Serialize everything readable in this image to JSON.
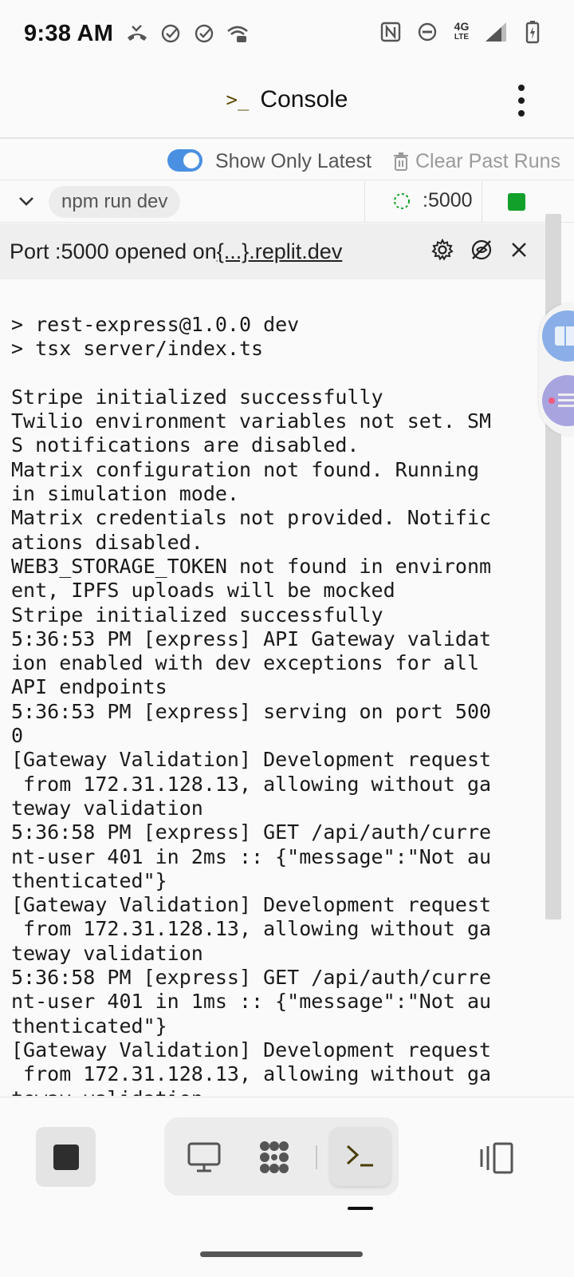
{
  "status_bar": {
    "time": "9:38 AM",
    "network_label": "4G",
    "network_sub": "LTE",
    "icons_left": [
      "missed-call-icon",
      "check-circle-icon",
      "check-circle-icon",
      "wifi-calling-icon"
    ],
    "icons_right": [
      "nfc-icon",
      "do-not-disturb-icon",
      "signal-icon",
      "battery-charging-icon"
    ]
  },
  "header": {
    "prompt_glyph": ">_",
    "title": "Console"
  },
  "toolbar": {
    "toggle_on": true,
    "toggle_label": "Show Only Latest",
    "clear_label": "Clear Past Runs"
  },
  "run": {
    "command": "npm run dev",
    "port_label": ":5000",
    "status_color": "#12a02a"
  },
  "port_banner": {
    "prefix": "Port :5000 opened on",
    "link": "{...}.replit.dev"
  },
  "console": {
    "output": "> rest-express@1.0.0 dev\n> tsx server/index.ts\n\nStripe initialized successfully\nTwilio environment variables not set. SM\nS notifications are disabled.\nMatrix configuration not found. Running\nin simulation mode.\nMatrix credentials not provided. Notific\nations disabled.\nWEB3_STORAGE_TOKEN not found in environm\nent, IPFS uploads will be mocked\nStripe initialized successfully\n5:36:53 PM [express] API Gateway validat\nion enabled with dev exceptions for all\nAPI endpoints\n5:36:53 PM [express] serving on port 500\n0\n[Gateway Validation] Development request\n from 172.31.128.13, allowing without ga\nteway validation\n5:36:58 PM [express] GET /api/auth/curre\nnt-user 401 in 2ms :: {\"message\":\"Not au\nthenticated\"}\n[Gateway Validation] Development request\n from 172.31.128.13, allowing without ga\nteway validation\n5:36:58 PM [express] GET /api/auth/curre\nnt-user 401 in 1ms :: {\"message\":\"Not au\nthenticated\"}\n[Gateway Validation] Development request\n from 172.31.128.13, allowing without ga\nteway validation"
  },
  "colors": {
    "accent": "#4a90e2",
    "running": "#12a02a",
    "prompt": "#5a4a00"
  }
}
